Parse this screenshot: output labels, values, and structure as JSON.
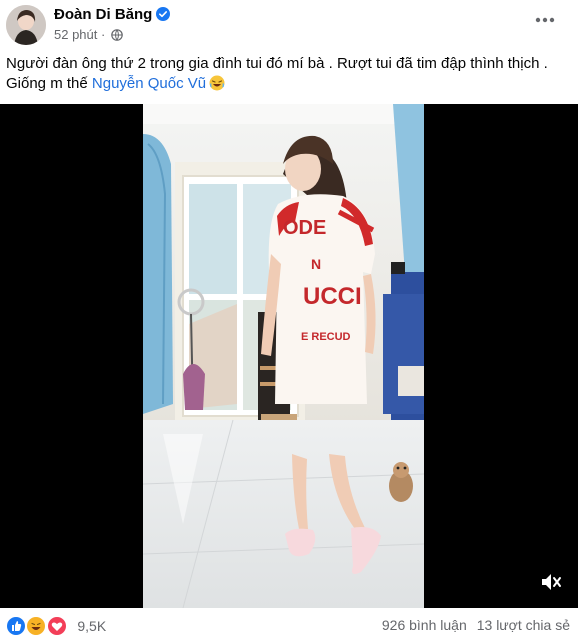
{
  "post": {
    "author": "Đoàn Di Băng",
    "time": "52 phút",
    "time_sep": " · ",
    "caption_line1": "Người đàn ông thứ 2 trong gia đình tui đó mí bà . Rượt tui đã tim đập thình thịch .",
    "caption_line2_prefix": "Giống m thế ",
    "mention": "Nguyễn Quốc Vũ",
    "icons": {
      "verified": "verified-badge-icon",
      "audience": "globe-icon",
      "more": "more-options-icon",
      "emoji": "rolling-laughing-emoji",
      "mute": "speaker-muted-icon"
    }
  },
  "video": {
    "sign_text": "ODE",
    "shirt_lines": [
      "N",
      "UCCI",
      "E RECUD"
    ]
  },
  "footer": {
    "reaction_types": [
      "like",
      "haha",
      "love"
    ],
    "reaction_count": "9,5K",
    "comments": "926 bình luận",
    "shares": "13 lượt chia sẻ"
  },
  "colors": {
    "link": "#216fdb",
    "verified": "#1877f2",
    "secondary_text": "#65676b",
    "like": "#1877f2",
    "haha": "#f7b125",
    "love": "#f33e58"
  }
}
